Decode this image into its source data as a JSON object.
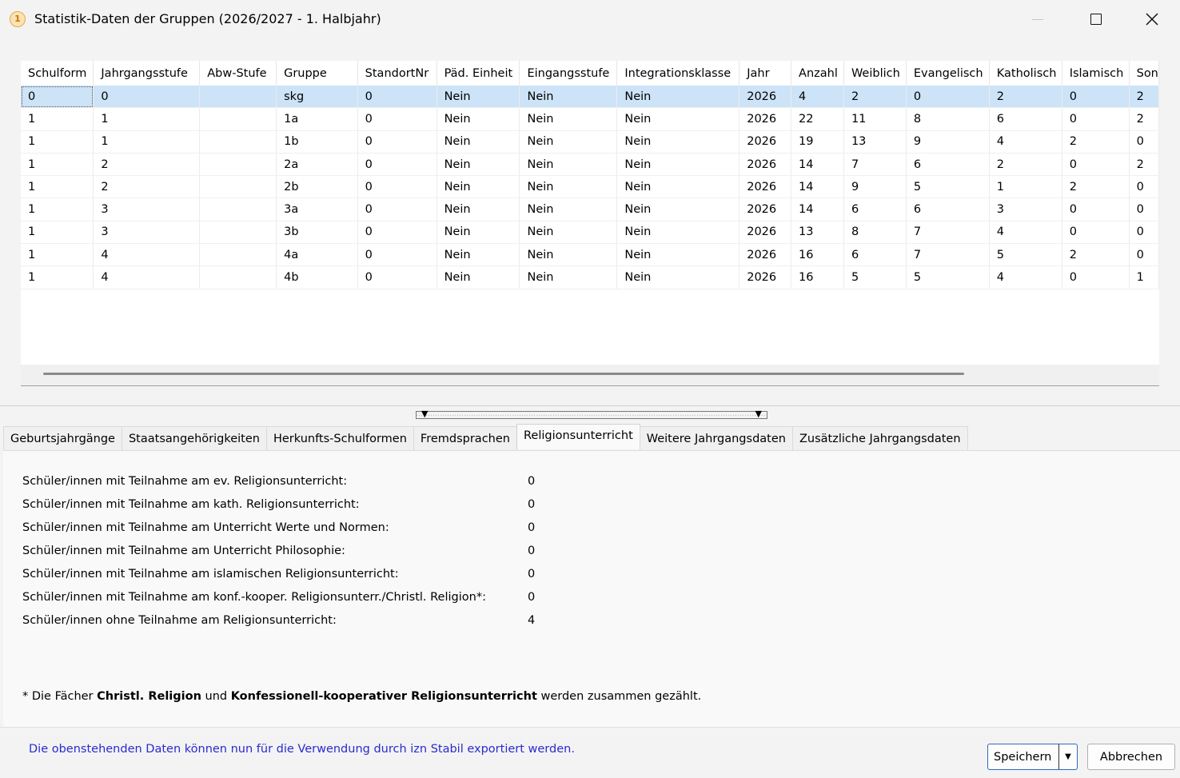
{
  "window": {
    "title": "Statistik-Daten der Gruppen (2026/2027 - 1. Halbjahr)",
    "app_icon_glyph": "1"
  },
  "grid": {
    "columns": [
      "Schulform",
      "Jahrgangsstufe",
      "Abw-Stufe",
      "Gruppe",
      "StandortNr",
      "Päd. Einheit",
      "Eingangsstufe",
      "Integrationsklasse",
      "Jahr",
      "Anzahl",
      "Weiblich",
      "Evangelisch",
      "Katholisch",
      "Islamisch",
      "Son"
    ],
    "rows": [
      [
        "0",
        "0",
        "",
        "skg",
        "0",
        "Nein",
        "Nein",
        "Nein",
        "2026",
        "4",
        "2",
        "0",
        "2",
        "0",
        "2"
      ],
      [
        "1",
        "1",
        "",
        "1a",
        "0",
        "Nein",
        "Nein",
        "Nein",
        "2026",
        "22",
        "11",
        "8",
        "6",
        "0",
        "2"
      ],
      [
        "1",
        "1",
        "",
        "1b",
        "0",
        "Nein",
        "Nein",
        "Nein",
        "2026",
        "19",
        "13",
        "9",
        "4",
        "2",
        "0"
      ],
      [
        "1",
        "2",
        "",
        "2a",
        "0",
        "Nein",
        "Nein",
        "Nein",
        "2026",
        "14",
        "7",
        "6",
        "2",
        "0",
        "2"
      ],
      [
        "1",
        "2",
        "",
        "2b",
        "0",
        "Nein",
        "Nein",
        "Nein",
        "2026",
        "14",
        "9",
        "5",
        "1",
        "2",
        "0"
      ],
      [
        "1",
        "3",
        "",
        "3a",
        "0",
        "Nein",
        "Nein",
        "Nein",
        "2026",
        "14",
        "6",
        "6",
        "3",
        "0",
        "0"
      ],
      [
        "1",
        "3",
        "",
        "3b",
        "0",
        "Nein",
        "Nein",
        "Nein",
        "2026",
        "13",
        "8",
        "7",
        "4",
        "0",
        "0"
      ],
      [
        "1",
        "4",
        "",
        "4a",
        "0",
        "Nein",
        "Nein",
        "Nein",
        "2026",
        "16",
        "6",
        "7",
        "5",
        "2",
        "0"
      ],
      [
        "1",
        "4",
        "",
        "4b",
        "0",
        "Nein",
        "Nein",
        "Nein",
        "2026",
        "16",
        "5",
        "5",
        "4",
        "0",
        "1"
      ]
    ],
    "selected_row": 0
  },
  "tabs": [
    "Geburtsjahrgänge",
    "Staatsangehörigkeiten",
    "Herkunfts-Schulformen",
    "Fremdsprachen",
    "Religionsunterricht",
    "Weitere Jahrgangsdaten",
    "Zusätzliche Jahrgangsdaten"
  ],
  "active_tab": "Religionsunterricht",
  "religion": {
    "items": [
      {
        "label": "Schüler/innen mit Teilnahme am ev. Religionsunterricht:",
        "value": "0"
      },
      {
        "label": "Schüler/innen mit Teilnahme am kath. Religionsunterricht:",
        "value": "0"
      },
      {
        "label": "Schüler/innen mit Teilnahme am Unterricht Werte und Normen:",
        "value": "0"
      },
      {
        "label": "Schüler/innen mit Teilnahme am Unterricht Philosophie:",
        "value": "0"
      },
      {
        "label": "Schüler/innen mit Teilnahme am islamischen Religionsunterricht:",
        "value": "0"
      },
      {
        "label": "Schüler/innen mit Teilnahme am konf.-kooper. Religionsunterr./Christl. Religion*:",
        "value": "0"
      },
      {
        "label": "Schüler/innen ohne Teilnahme am Religionsunterricht:",
        "value": "4"
      }
    ],
    "footnote": {
      "prefix": "* Die Fächer ",
      "bold1": "Christl. Religion",
      "mid": " und ",
      "bold2": "Konfessionell-kooperativer Religionsunterricht",
      "suffix": " werden zusammen gezählt."
    }
  },
  "footer": {
    "info": "Die obenstehenden Daten können nun für die Verwendung durch izn Stabil  exportiert werden.",
    "save_label": "Speichern",
    "cancel_label": "Abbrechen"
  },
  "colors": {
    "selection": "#cde3f7",
    "info_text": "#2a2ad0"
  }
}
